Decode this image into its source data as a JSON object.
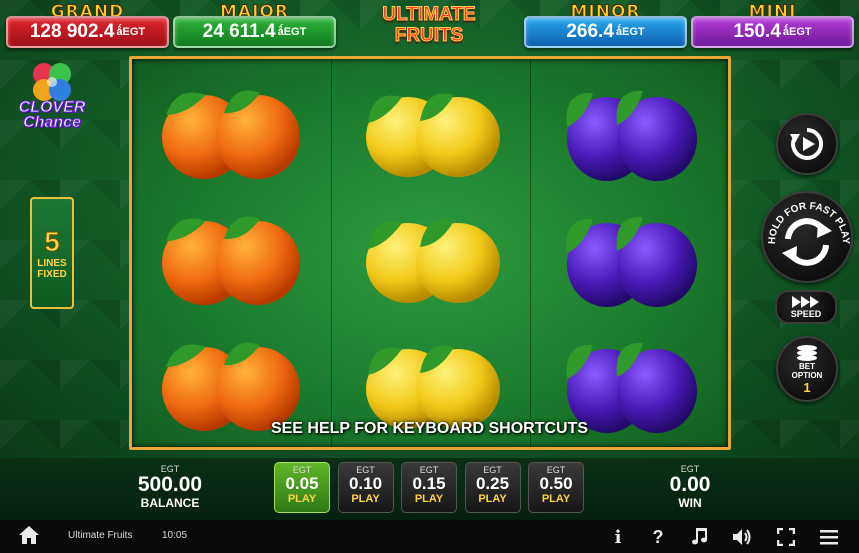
{
  "jackpots": {
    "grand": {
      "title": "GRAND",
      "amount": "128 902.4",
      "currency": "ǻEGT"
    },
    "major": {
      "title": "MAJOR",
      "amount": "24 611.4",
      "currency": "ǻEGT"
    },
    "minor": {
      "title": "MINOR",
      "amount": "266.4",
      "currency": "ǻEGT"
    },
    "mini": {
      "title": "MINI",
      "amount": "150.4",
      "currency": "ǻEGT"
    }
  },
  "game_logo": {
    "line1": "ULTIMATE",
    "line2": "FRUITS"
  },
  "clover_logo": {
    "line1": "CLOVER",
    "line2": "Chance"
  },
  "lines": {
    "count": "5",
    "label1": "LINES",
    "label2": "FIXED"
  },
  "reels": [
    {
      "symbols": [
        "orange",
        "orange",
        "orange"
      ]
    },
    {
      "symbols": [
        "lemon",
        "lemon",
        "lemon"
      ]
    },
    {
      "symbols": [
        "plum",
        "plum",
        "plum"
      ]
    }
  ],
  "help_hint": "SEE HELP FOR KEYBOARD SHORTCUTS",
  "controls": {
    "spin_hint": "HOLD FOR FAST PLAY",
    "speed_label": "SPEED",
    "bet_option_label1": "BET",
    "bet_option_label2": "OPTION",
    "bet_option_value": "1"
  },
  "balance": {
    "currency": "EGT",
    "value": "500.00",
    "label": "BALANCE"
  },
  "win": {
    "currency": "EGT",
    "value": "0.00",
    "label": "WIN"
  },
  "bets": [
    {
      "currency": "EGT",
      "value": "0.05",
      "label": "PLAY",
      "active": true
    },
    {
      "currency": "EGT",
      "value": "0.10",
      "label": "PLAY",
      "active": false
    },
    {
      "currency": "EGT",
      "value": "0.15",
      "label": "PLAY",
      "active": false
    },
    {
      "currency": "EGT",
      "value": "0.25",
      "label": "PLAY",
      "active": false
    },
    {
      "currency": "EGT",
      "value": "0.50",
      "label": "PLAY",
      "active": false
    }
  ],
  "footer": {
    "game_name": "Ultimate Fruits",
    "clock": "10:05",
    "icons": [
      "home-icon",
      "info-icon",
      "help-icon",
      "music-icon",
      "sound-icon",
      "fullscreen-icon",
      "menu-icon"
    ]
  },
  "colors": {
    "grand": "#e0252d",
    "major": "#2fb43a",
    "minor": "#27a7ea",
    "mini": "#b43ad6",
    "frame": "#e8a637",
    "accent": "#ffd34a",
    "active_bet": "#5eb72a"
  }
}
